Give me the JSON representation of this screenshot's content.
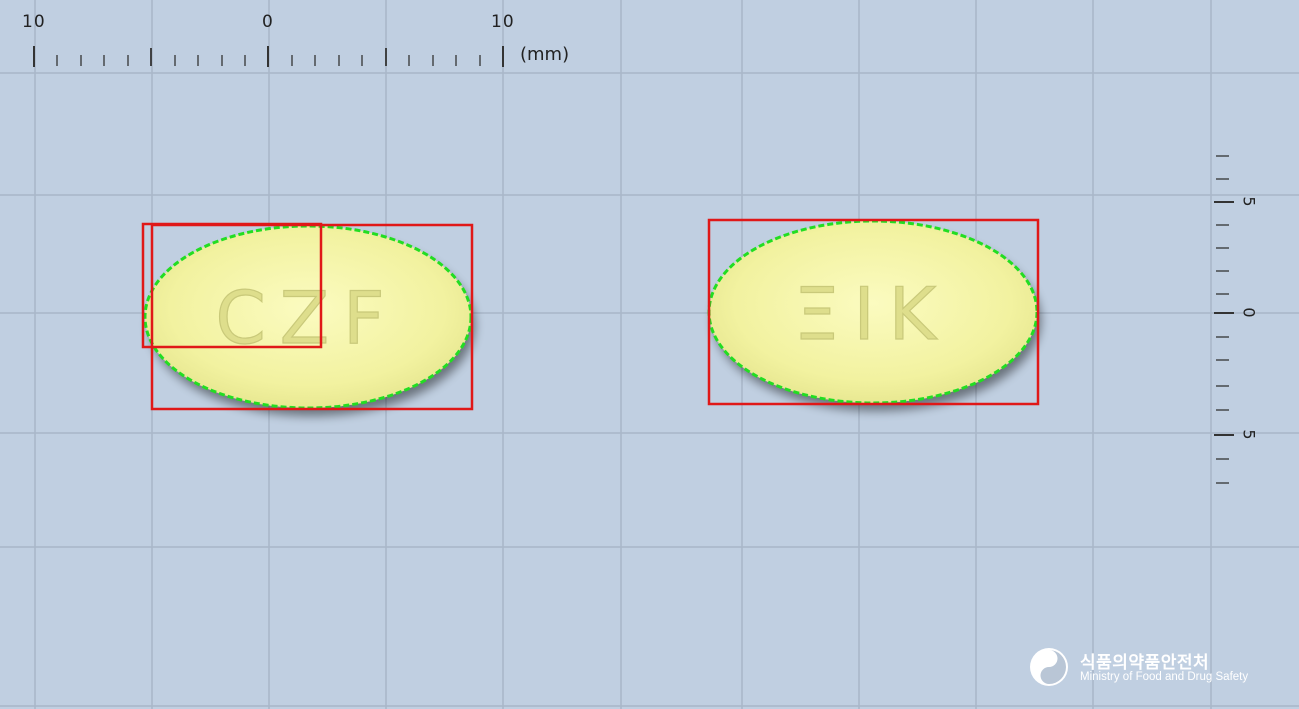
{
  "ruler_top": {
    "labels": [
      "10",
      "0",
      "10"
    ],
    "unit": "(mm)"
  },
  "ruler_right": {
    "labels": [
      "5",
      "0",
      "5"
    ]
  },
  "pills": [
    {
      "imprint": "CZF",
      "color": "#f4f4a6"
    },
    {
      "imprint": "ΞIK",
      "color": "#f4f4a6"
    }
  ],
  "annotation": {
    "box_color": "#e01818",
    "contour_color": "#22dd22"
  },
  "logo": {
    "name_ko": "식품의약품안전처",
    "name_en": "Ministry of Food and Drug Safety",
    "icon": "mfds-emblem-icon"
  }
}
